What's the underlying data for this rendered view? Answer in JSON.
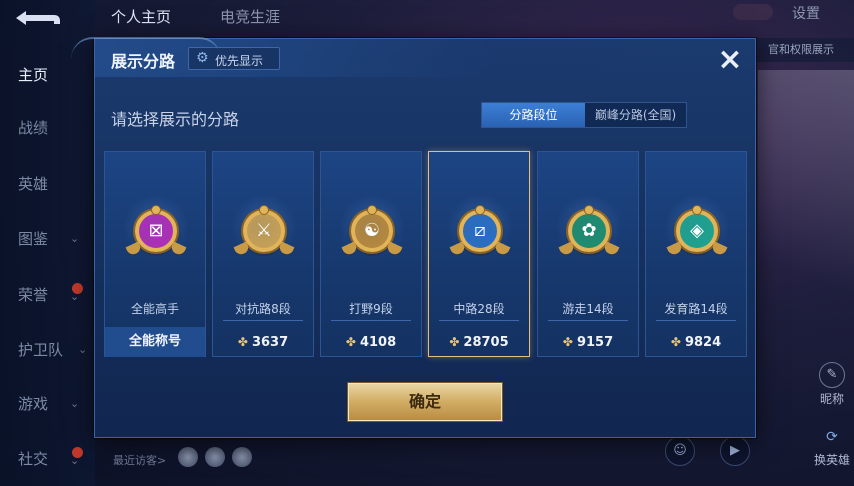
{
  "sidebar": {
    "items": [
      {
        "label": "主页",
        "active": true
      },
      {
        "label": "战绩"
      },
      {
        "label": "英雄"
      },
      {
        "label": "图鉴"
      },
      {
        "label": "荣誉"
      },
      {
        "label": "护卫队"
      },
      {
        "label": "游戏"
      },
      {
        "label": "社交"
      }
    ]
  },
  "top_tabs": [
    {
      "label": "个人主页",
      "active": true
    },
    {
      "label": "电竞生涯"
    }
  ],
  "header": {
    "settings_label": "设置",
    "hint_banner": "官和权限展示"
  },
  "right_buttons": {
    "rename_label": "昵称",
    "swap_label": "换英雄"
  },
  "recent_visitors_label": "最近访客>",
  "modal": {
    "title": "展示分路",
    "priority_label": "优先显示",
    "close_icon": "×",
    "subtitle": "请选择展示的分路",
    "toggle": {
      "rank_label": "分路段位",
      "peak_label": "巅峰分路(全国)",
      "selected": "rank"
    },
    "lanes": [
      {
        "name": "全能高手",
        "footer": "全能称号",
        "badge_color": "#b02fb8",
        "icon": "⊠"
      },
      {
        "name": "对抗路8段",
        "score": "3637",
        "badge_color": "#caa255",
        "icon": "⚔"
      },
      {
        "name": "打野9段",
        "score": "4108",
        "badge_color": "#b98a3c",
        "icon": "☯"
      },
      {
        "name": "中路28段",
        "score": "28705",
        "badge_color": "#2a6fc4",
        "icon": "⧄",
        "selected": true
      },
      {
        "name": "游走14段",
        "score": "9157",
        "badge_color": "#1f8f6e",
        "icon": "✿"
      },
      {
        "name": "发育路14段",
        "score": "9824",
        "badge_color": "#1fa58f",
        "icon": "◈"
      }
    ],
    "confirm_label": "确定"
  },
  "colors": {
    "accent_gold": "#e2b45a",
    "modal_bg": "#1b3a6e",
    "toggle_active": "#3c7fd6"
  }
}
